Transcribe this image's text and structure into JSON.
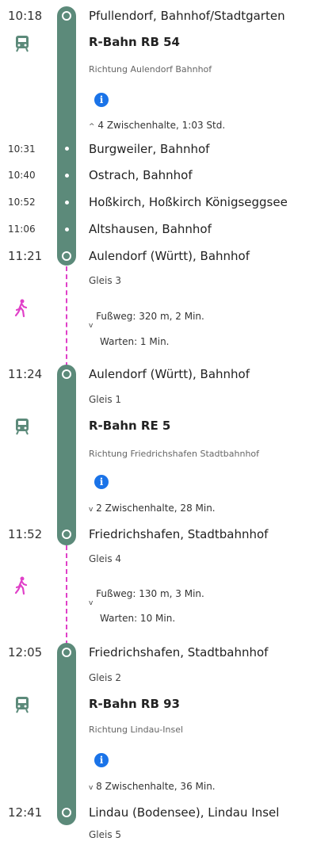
{
  "colors": {
    "line": "#5c8a7a",
    "walk": "#e040c8",
    "info": "#1a73e8"
  },
  "icons": {
    "train": "train-icon",
    "walk": "walk-icon",
    "info": "info-icon"
  },
  "legs": [
    {
      "start_time": "10:18",
      "start_stop": "Pfullendorf, Bahnhof/Stadtgarten",
      "train": "R-Bahn RB 54",
      "direction": "Richtung Aulendorf Bahnhof",
      "intermediate_toggle": "4 Zwischenhalte, 1:03 Std.",
      "intermediate_stops": [
        {
          "time": "10:31",
          "name": "Burgweiler, Bahnhof"
        },
        {
          "time": "10:40",
          "name": "Ostrach, Bahnhof"
        },
        {
          "time": "10:52",
          "name": "Hoßkirch, Hoßkirch Königseggsee"
        },
        {
          "time": "11:06",
          "name": "Altshausen, Bahnhof"
        }
      ],
      "end_time": "11:21",
      "end_stop": "Aulendorf (Württ), Bahnhof",
      "end_platform": "Gleis 3"
    },
    {
      "start_time": "11:24",
      "start_stop": "Aulendorf (Württ), Bahnhof",
      "start_platform": "Gleis 1",
      "train": "R-Bahn RE 5",
      "direction": "Richtung Friedrichshafen Stadtbahnhof",
      "intermediate_toggle": "2 Zwischenhalte, 28 Min.",
      "end_time": "11:52",
      "end_stop": "Friedrichshafen, Stadtbahnhof",
      "end_platform": "Gleis 4"
    },
    {
      "start_time": "12:05",
      "start_stop": "Friedrichshafen, Stadtbahnhof",
      "start_platform": "Gleis 2",
      "train": "R-Bahn RB 93",
      "direction": "Richtung Lindau-Insel",
      "intermediate_toggle": "8 Zwischenhalte, 36 Min.",
      "end_time": "12:41",
      "end_stop": "Lindau (Bodensee), Lindau Insel",
      "end_platform": "Gleis 5"
    }
  ],
  "transfers": [
    {
      "walk": "Fußweg: 320 m, 2 Min.",
      "wait": "Warten: 1 Min."
    },
    {
      "walk": "Fußweg: 130 m, 3 Min.",
      "wait": "Warten: 10 Min."
    }
  ]
}
